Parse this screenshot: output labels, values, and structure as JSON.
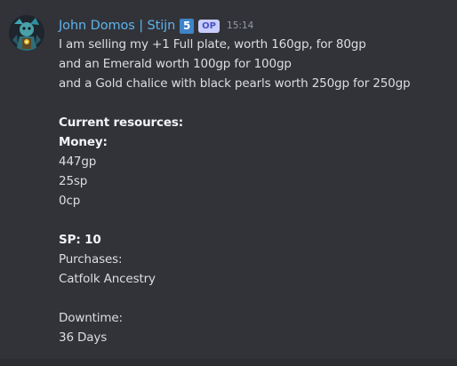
{
  "message": {
    "author": "John Domos | Stijn",
    "level_badge": "5",
    "op_badge": "OP",
    "timestamp": "15:14",
    "lines": [
      "I am selling my +1 Full plate, worth 160gp, for 80gp",
      "and an Emerald worth 100gp for 100gp",
      "and a Gold chalice with black pearls worth 250gp for 250gp",
      "",
      "Current resources:",
      "Money:",
      "447gp",
      "25sp",
      "0cp",
      "",
      "SP: 10",
      "Purchases:",
      "Catfolk Ancestry",
      "",
      "Downtime:",
      "36 Days"
    ]
  },
  "colors": {
    "background": "#323339",
    "username": "#5db3ea",
    "level_badge": "#3e84c6",
    "op_badge_bg": "#c9cdfb",
    "op_badge_text": "#4752c4",
    "text": "#dbdee1",
    "timestamp": "#949ba4"
  },
  "icons": {
    "avatar": "character-avatar-icon"
  }
}
